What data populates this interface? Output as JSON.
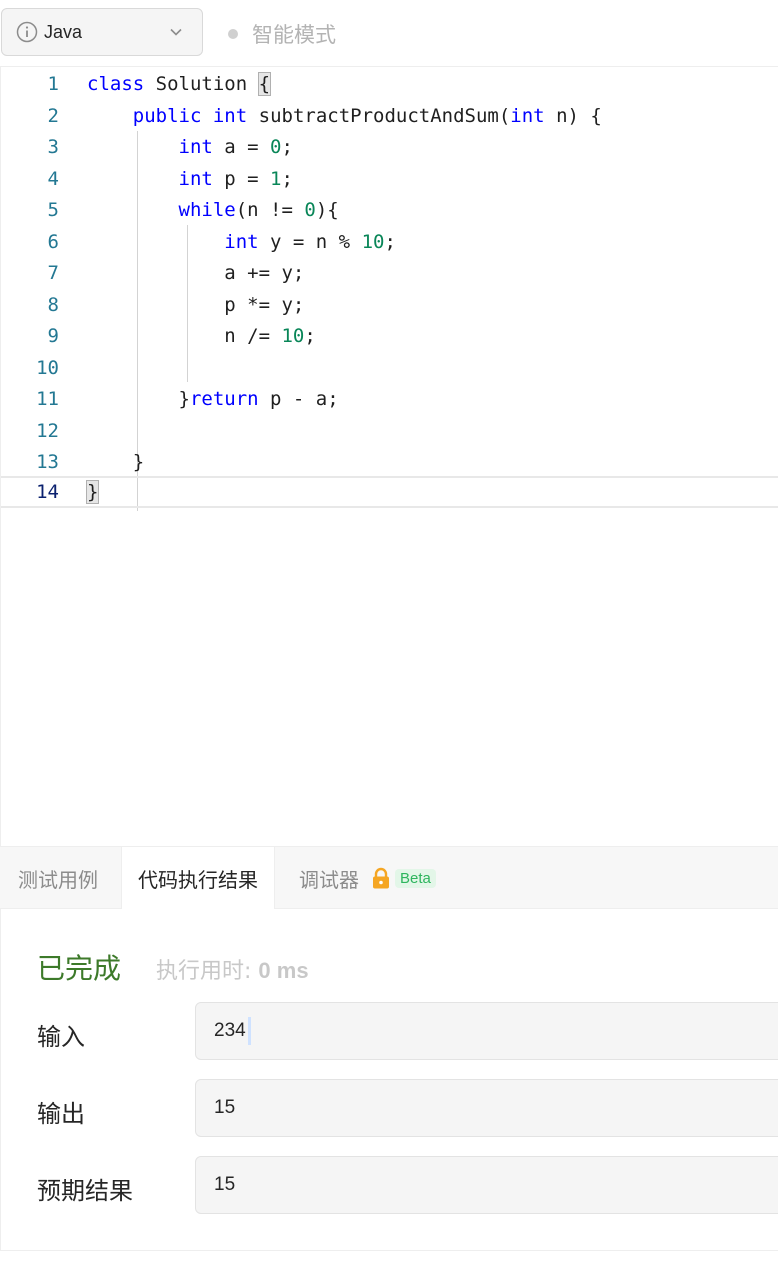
{
  "toolbar": {
    "language": "Java",
    "smart_mode_label": "智能模式"
  },
  "editor": {
    "line_numbers": [
      "1",
      "2",
      "3",
      "4",
      "5",
      "6",
      "7",
      "8",
      "9",
      "10",
      "11",
      "12",
      "13",
      "14"
    ],
    "code": {
      "l1_kw": "class",
      "l1_rest": " Solution ",
      "l1_brace": "{",
      "l2_kw1": "public",
      "l2_kw2": "int",
      "l2_name": " subtractProductAndSum(",
      "l2_kw3": "int",
      "l2_rest": " n) {",
      "l3_kw": "int",
      "l3_rest": " a = ",
      "l3_num": "0",
      "l3_end": ";",
      "l4_kw": "int",
      "l4_rest": " p = ",
      "l4_num": "1",
      "l4_end": ";",
      "l5_kw": "while",
      "l5_rest": "(n != ",
      "l5_num": "0",
      "l5_end": "){",
      "l6_kw": "int",
      "l6_rest": " y = n % ",
      "l6_num": "10",
      "l6_end": ";",
      "l7": "a += y;",
      "l8": "p *= y;",
      "l9_rest": "n /= ",
      "l9_num": "10",
      "l9_end": ";",
      "l11_brace": "}",
      "l11_kw": "return",
      "l11_rest": " p - a;",
      "l13": "}",
      "l14": "}"
    },
    "active_line": 14
  },
  "tabs": {
    "testcase": "测试用例",
    "result": "代码执行结果",
    "debugger": "调试器",
    "beta": "Beta"
  },
  "result": {
    "status": "已完成",
    "runtime_label": "执行用时:",
    "runtime_value": "0 ms",
    "input_label": "输入",
    "input_value": "234",
    "output_label": "输出",
    "output_value": "15",
    "expected_label": "预期结果",
    "expected_value": "15"
  },
  "colors": {
    "keyword": "#0000ff",
    "number": "#098658",
    "line_number": "#237893",
    "status_green": "#3d7a2a",
    "beta_green": "#2db55d",
    "lock_orange": "#f5a623"
  },
  "icons": {
    "language": "info-icon",
    "dropdown": "chevron-down-icon",
    "debugger_lock": "lock-icon"
  }
}
